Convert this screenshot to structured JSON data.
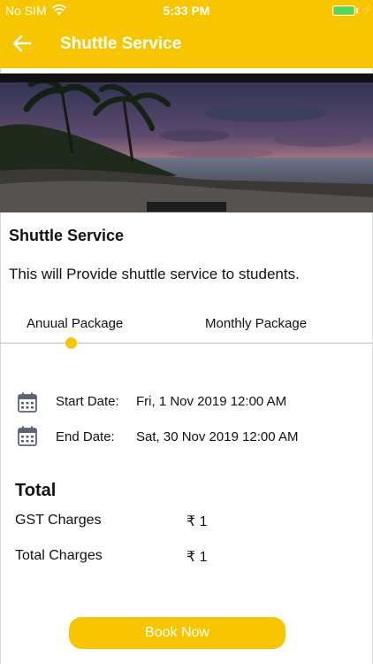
{
  "status_bar": {
    "carrier": "No SIM",
    "time": "5:33 PM"
  },
  "nav": {
    "title": "Shuttle Service"
  },
  "service": {
    "title": "Shuttle Service",
    "description": "This will Provide shuttle service to students."
  },
  "tabs": [
    {
      "label": "Anuual Package",
      "selected": true
    },
    {
      "label": "Monthly Package",
      "selected": false
    }
  ],
  "dates": {
    "start_label": "Start Date:",
    "start_value": "Fri, 1 Nov 2019 12:00 AM",
    "end_label": "End Date:",
    "end_value": "Sat, 30 Nov 2019 12:00 AM"
  },
  "totals": {
    "heading": "Total",
    "gst_label": "GST Charges",
    "gst_value": "₹ 1",
    "total_label": "Total Charges",
    "total_value": "₹ 1"
  },
  "actions": {
    "book_label": "Book Now"
  },
  "colors": {
    "accent": "#F8C600",
    "battery": "#4CD964"
  }
}
